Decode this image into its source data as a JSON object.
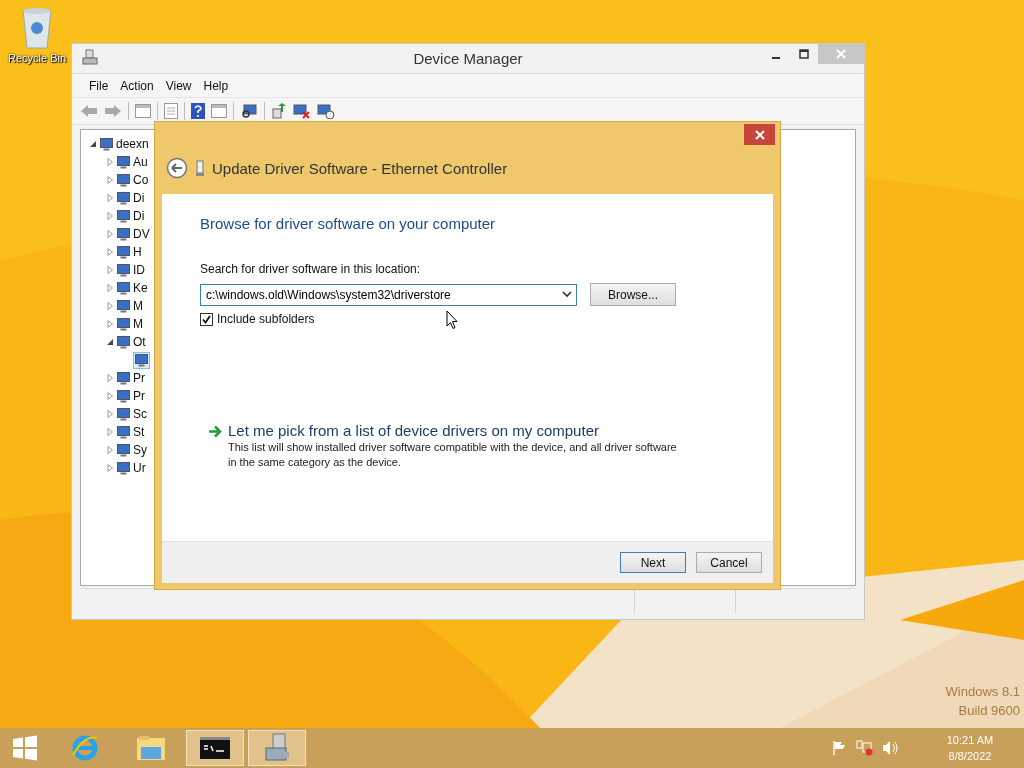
{
  "desktop": {
    "icons": [
      {
        "label": "Recycle Bin"
      }
    ],
    "watermark": [
      "Windows 8.1",
      "Build 9600"
    ]
  },
  "device_manager": {
    "title": "Device Manager",
    "menu": [
      "File",
      "Action",
      "View",
      "Help"
    ],
    "tree": {
      "label": "deexn",
      "expanded": true,
      "children": [
        {
          "label": "Au",
          "expanded": false,
          "selected": false
        },
        {
          "label": "Co",
          "expanded": false,
          "selected": false
        },
        {
          "label": "Di",
          "expanded": false,
          "selected": false
        },
        {
          "label": "Di",
          "expanded": false,
          "selected": false
        },
        {
          "label": "DV",
          "expanded": false,
          "selected": false
        },
        {
          "label": "H",
          "expanded": false,
          "selected": false
        },
        {
          "label": "ID",
          "expanded": false,
          "selected": false
        },
        {
          "label": "Ke",
          "expanded": false,
          "selected": false
        },
        {
          "label": "M",
          "expanded": false,
          "selected": false
        },
        {
          "label": "M",
          "expanded": false,
          "selected": false
        },
        {
          "label": "Ot",
          "expanded": true,
          "selected": false,
          "children": [
            {
              "selected": true
            }
          ]
        },
        {
          "label": "Pr",
          "expanded": false,
          "selected": false
        },
        {
          "label": "Pr",
          "expanded": false,
          "selected": false
        },
        {
          "label": "Sc",
          "expanded": false,
          "selected": false
        },
        {
          "label": "St",
          "expanded": false,
          "selected": false
        },
        {
          "label": "Sy",
          "expanded": false,
          "selected": false
        },
        {
          "label": "Ur",
          "expanded": false,
          "selected": false
        }
      ]
    }
  },
  "dialog": {
    "title": "Update Driver Software - Ethernet Controller",
    "heading": "Browse for driver software on your computer",
    "location_label": "Search for driver software in this location:",
    "location_value": "c:\\windows.old\\Windows\\system32\\driverstore",
    "browse": "Browse...",
    "include_subfolders": {
      "label": "Include subfolders",
      "checked": true
    },
    "pick": {
      "title": "Let me pick from a list of device drivers on my computer",
      "description": "This list will show installed driver software compatible with the device, and all driver software in the same category as the device."
    },
    "buttons": [
      {
        "label": "Next",
        "default": true
      },
      {
        "label": "Cancel",
        "default": false
      }
    ]
  },
  "taskbar": {
    "apps": [
      {
        "kind": "start",
        "active": false
      },
      {
        "kind": "browser",
        "active": false
      },
      {
        "kind": "files",
        "active": false
      },
      {
        "kind": "terminal",
        "active": true
      },
      {
        "kind": "devices",
        "active": true
      }
    ],
    "clock": {
      "time": "10:21 AM",
      "date": "8/8/2022"
    }
  }
}
